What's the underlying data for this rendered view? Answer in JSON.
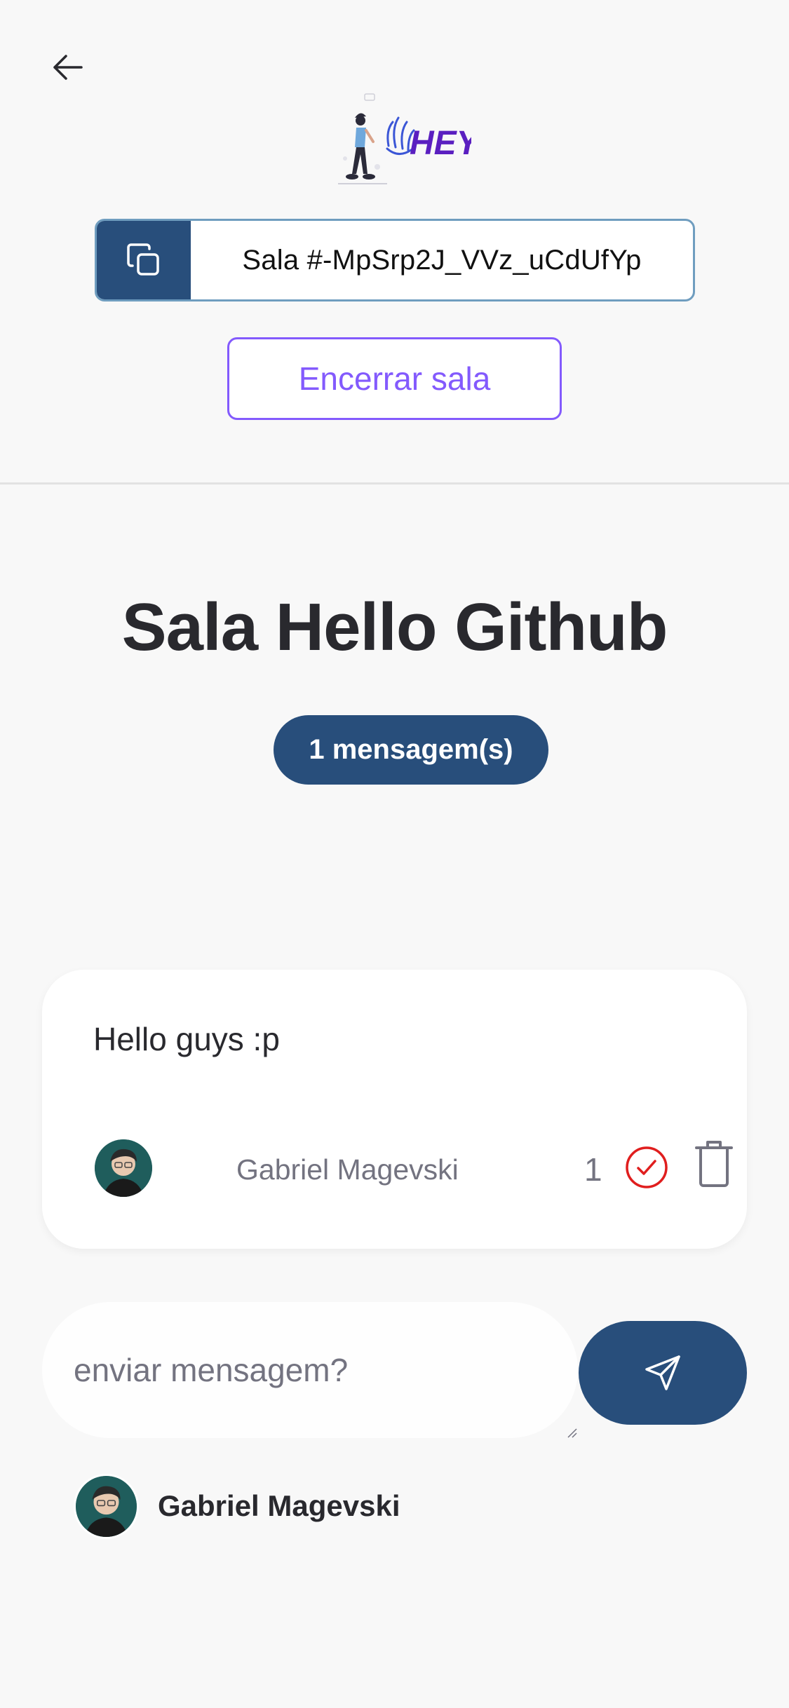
{
  "header": {
    "back_icon": "arrow-left-icon",
    "logo": {
      "text": "HEY",
      "colors": [
        "#3b56d6",
        "#7b2ff0",
        "#5a1fc0"
      ]
    },
    "room_code": {
      "label": "Sala #-MpSrp2J_VVz_uCdUfYp",
      "icon": "copy-icon",
      "accent": "#284e7b",
      "border": "#6f9dbf"
    },
    "end_room_label": "Encerrar sala",
    "end_room_color": "#835afd"
  },
  "room": {
    "title": "Sala Hello Github",
    "message_count": "1 mensagem(s)",
    "badge_color": "#284e7b"
  },
  "questions": [
    {
      "text": "Hello guys :p",
      "author": "Gabriel Magevski",
      "likes": "1",
      "check_icon": "check-circle-icon",
      "check_color": "#e01e1e",
      "delete_icon": "trash-icon"
    }
  ],
  "composer": {
    "placeholder": "enviar mensagem?",
    "send_icon": "send-icon"
  },
  "user": {
    "name": "Gabriel Magevski"
  }
}
